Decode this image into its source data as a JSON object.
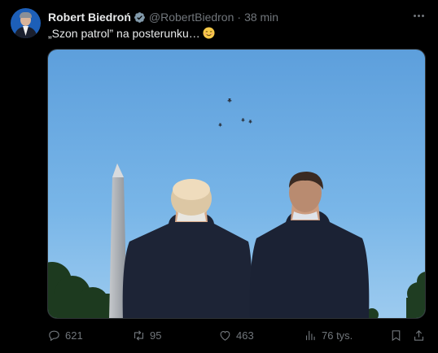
{
  "author": {
    "name": "Robert Biedroń",
    "handle": "@RobertBiedron",
    "separator": "·",
    "time": "38 min"
  },
  "tweet": {
    "text": "„Szon patrol” na posterunku…"
  },
  "actions": {
    "replies": "621",
    "reposts": "95",
    "likes": "463",
    "views": "76 tys."
  },
  "colors": {
    "background": "#000000",
    "text": "#e7e9ea",
    "muted": "#71767b",
    "verified": "#829aab",
    "sky": "#6aa9e0"
  },
  "icons": [
    "verified-badge-icon",
    "more-icon",
    "relaxed-face-emoji-icon",
    "reply-icon",
    "repost-icon",
    "like-icon",
    "views-icon",
    "bookmark-icon",
    "share-icon"
  ]
}
